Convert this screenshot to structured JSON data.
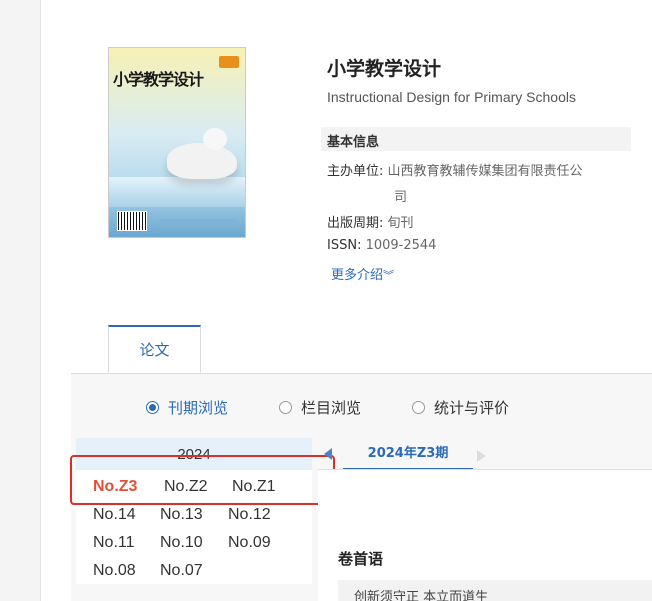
{
  "journal": {
    "cover_title": "小学教学设计",
    "title": "小学教学设计",
    "subtitle": "Instructional Design for Primary Schools",
    "info_heading": "基本信息",
    "sponsor_label": "主办单位:",
    "sponsor_line1": "山西教育教辅传媒集团有限责任公",
    "sponsor_line2": "司",
    "frequency_label": "出版周期:",
    "frequency": "旬刊",
    "issn_label": "ISSN:",
    "issn": "1009-2544",
    "more": "更多介绍"
  },
  "tabs": {
    "papers": "论文"
  },
  "browse": {
    "by_issue": "刊期浏览",
    "by_column": "栏目浏览",
    "stats": "统计与评价"
  },
  "years": {
    "year": "2024",
    "issues": [
      "No.Z3",
      "No.Z2",
      "No.Z1",
      "No.14",
      "No.13",
      "No.12",
      "No.11",
      "No.10",
      "No.09",
      "No.08",
      "No.07"
    ],
    "active": "No.Z3"
  },
  "issue_panel": {
    "current": "2024年Z3期",
    "section": "卷首语",
    "first_article": "创新须守正 本立而道生"
  },
  "colors": {
    "accent": "#2a6ab8",
    "active_issue": "#e0503a",
    "highlight_box": "#d9302a"
  }
}
